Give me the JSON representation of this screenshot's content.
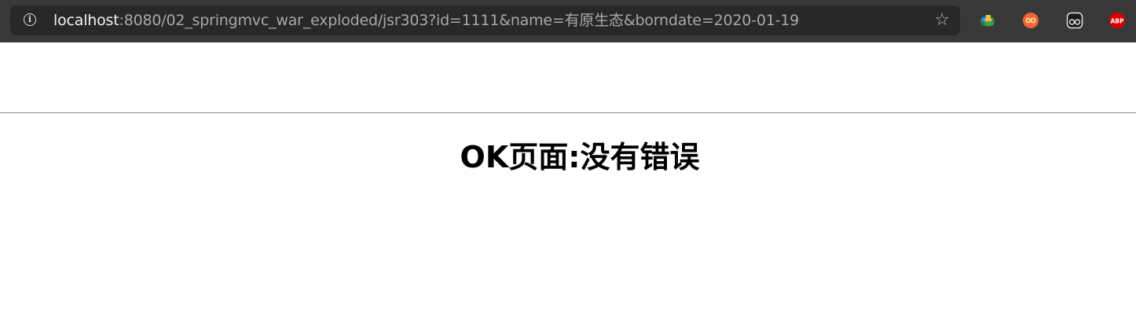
{
  "browser": {
    "address_bar": {
      "host": "localhost",
      "rest": ":8080/02_springmvc_war_exploded/jsr303?id=1111&name=有原生态&borndate=2020-01-19"
    },
    "extensions": [
      "download-manager-icon",
      "infinity-icon",
      "tab-face-icon",
      "adblock-plus-icon"
    ]
  },
  "page": {
    "heading": "OK页面:没有错误"
  }
}
